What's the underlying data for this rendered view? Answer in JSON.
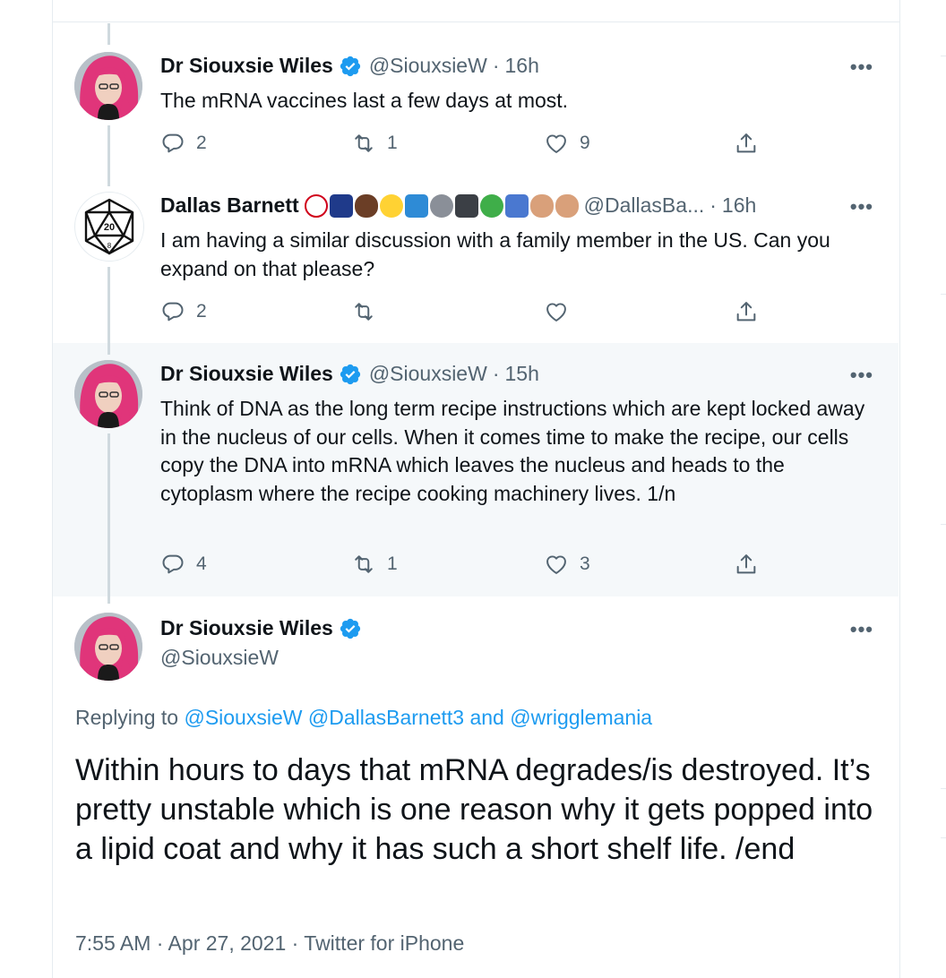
{
  "colors": {
    "accent": "#1d9bf0",
    "muted": "#536471",
    "text": "#0f1419",
    "highlight_bg": "#f5f8fa"
  },
  "tweets": [
    {
      "name": "Dr Siouxsie Wiles",
      "verified": true,
      "handle": "@SiouxsieW",
      "time": "16h",
      "text": "The mRNA vaccines last a few days at most.",
      "replies": "2",
      "retweets": "1",
      "likes": "9"
    },
    {
      "name": "Dallas Barnett",
      "handle": "@DallasBa...",
      "time": "16h",
      "emoji_icons": [
        "no-under-18",
        "nz-flag",
        "raised-fist",
        "face-with-mask",
        "male-sign",
        "microphone",
        "clapper-board",
        "dragon",
        "mage",
        "sign-of-horns",
        "raised-finger"
      ],
      "text": "I am having a similar discussion with a family member in the US. Can you expand on that please?",
      "replies": "2",
      "retweets": "",
      "likes": ""
    },
    {
      "name": "Dr Siouxsie Wiles",
      "verified": true,
      "handle": "@SiouxsieW",
      "time": "15h",
      "text": "Think of DNA as the long term recipe instructions which are kept locked away in the nucleus of our cells. When it comes time to make the recipe, our cells copy the DNA into mRNA which leaves the nucleus and heads to the cytoplasm where the recipe cooking machinery lives. 1/n",
      "replies": "4",
      "retweets": "1",
      "likes": "3"
    }
  ],
  "main": {
    "name": "Dr Siouxsie Wiles",
    "verified": true,
    "handle": "@SiouxsieW",
    "replying_label": "Replying to",
    "replying_to": [
      "@SiouxsieW",
      "@DallasBarnett3"
    ],
    "replying_and": "and",
    "replying_last": "@wrigglemania",
    "text": "Within hours to days that mRNA degrades/is destroyed. It’s pretty unstable which is one reason why it gets popped into a lipid coat and why it has such a short shelf life. /end",
    "footer": "7:55 AM · Apr 27, 2021 · Twitter for iPhone"
  },
  "more_label": "•••"
}
